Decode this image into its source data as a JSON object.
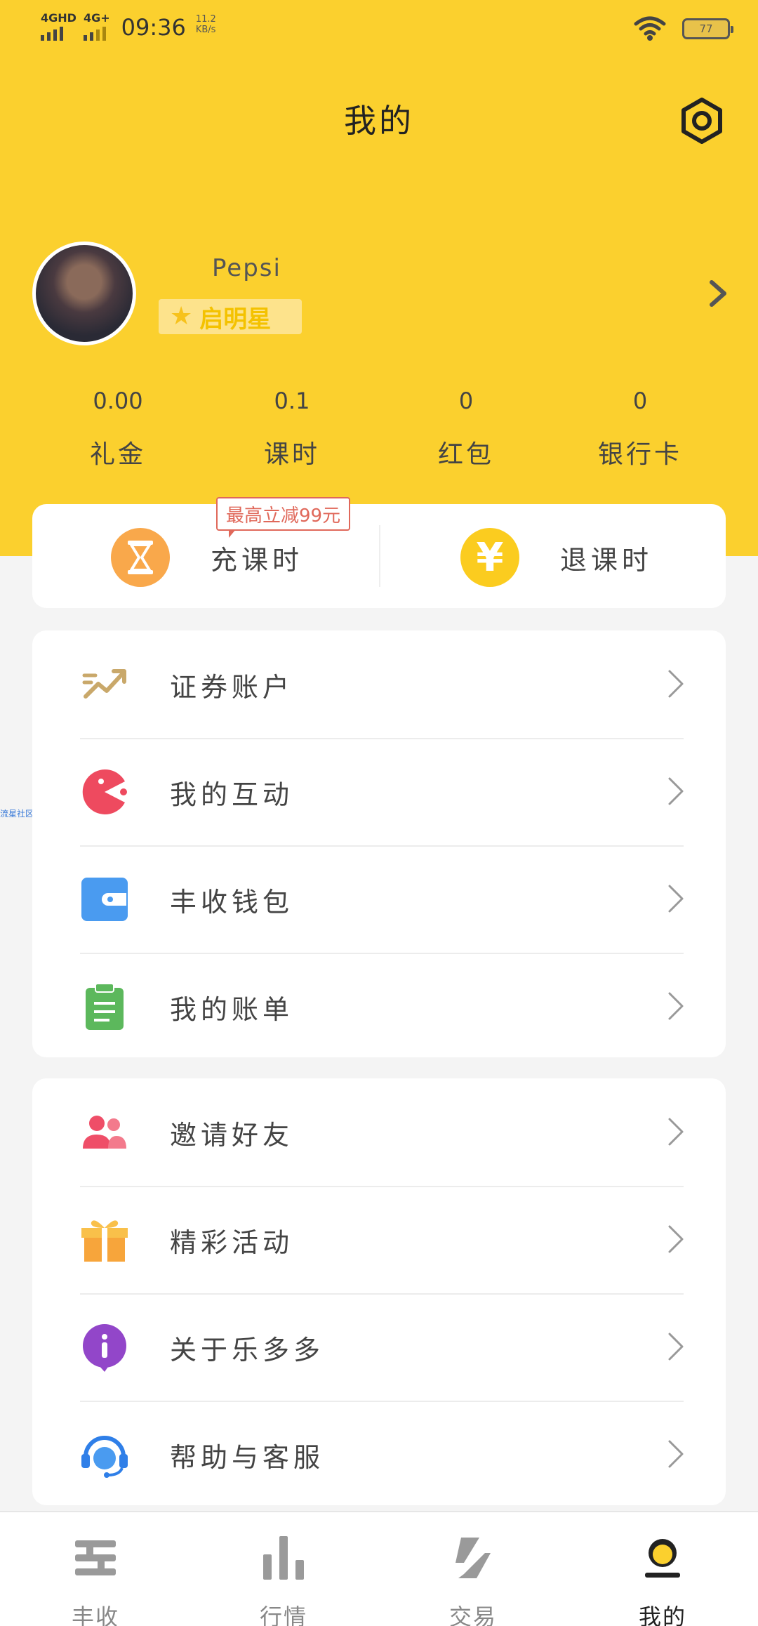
{
  "status_bar": {
    "signal1": "4GHD",
    "signal2": "4G+",
    "time": "09:36",
    "speed_value": "11.2",
    "speed_unit": "KB/s",
    "battery": "77"
  },
  "header": {
    "title": "我的"
  },
  "profile": {
    "username": "Pepsi",
    "badge": "启明星"
  },
  "stats": [
    {
      "value": "0.00",
      "label": "礼金"
    },
    {
      "value": "0.1",
      "label": "课时"
    },
    {
      "value": "0",
      "label": "红包"
    },
    {
      "value": "0",
      "label": "银行卡"
    }
  ],
  "course": {
    "promo": "最高立减99元",
    "recharge_label": "充课时",
    "refund_label": "退课时",
    "refund_symbol": "¥"
  },
  "side_label": "流星社区",
  "menu_group1": [
    {
      "label": "证券账户",
      "icon": "trend-chart-icon"
    },
    {
      "label": "我的互动",
      "icon": "pacman-icon"
    },
    {
      "label": "丰收钱包",
      "icon": "wallet-icon"
    },
    {
      "label": "我的账单",
      "icon": "clipboard-icon"
    }
  ],
  "menu_group2": [
    {
      "label": "邀请好友",
      "icon": "friends-icon"
    },
    {
      "label": "精彩活动",
      "icon": "gift-icon"
    },
    {
      "label": "关于乐多多",
      "icon": "info-icon"
    },
    {
      "label": "帮助与客服",
      "icon": "headset-icon"
    }
  ],
  "tabs": [
    {
      "label": "丰收",
      "icon": "harvest-icon"
    },
    {
      "label": "行情",
      "icon": "bar-chart-icon"
    },
    {
      "label": "交易",
      "icon": "trade-icon"
    },
    {
      "label": "我的",
      "icon": "profile-icon",
      "active": true
    }
  ],
  "colors": {
    "header_yellow": "#fbd02e",
    "promo_red": "#e0685a",
    "recharge_orange": "#f9a84b",
    "refund_yellow": "#fbcc1f"
  }
}
